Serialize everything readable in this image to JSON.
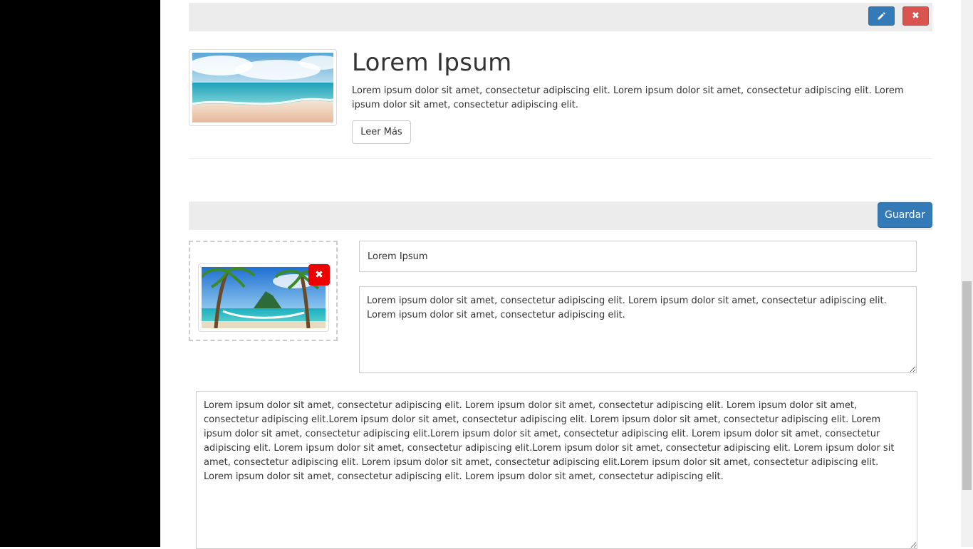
{
  "article": {
    "title": "Lorem Ipsum",
    "summary": "Lorem ipsum dolor sit amet, consectetur adipiscing elit. Lorem ipsum dolor sit amet, consectetur adipiscing elit. Lorem ipsum dolor sit amet, consectetur adipiscing elit.",
    "read_more_label": "Leer Más",
    "edit_icon": "pencil-icon",
    "delete_icon": "close-icon"
  },
  "editor": {
    "save_label": "Guardar",
    "title_value": "Lorem Ipsum",
    "summary_value": "Lorem ipsum dolor sit amet, consectetur adipiscing elit. Lorem ipsum dolor sit amet, consectetur adipiscing elit. Lorem ipsum dolor sit amet, consectetur adipiscing elit.",
    "body_value": "Lorem ipsum dolor sit amet, consectetur adipiscing elit. Lorem ipsum dolor sit amet, consectetur adipiscing elit. Lorem ipsum dolor sit amet, consectetur adipiscing elit.Lorem ipsum dolor sit amet, consectetur adipiscing elit. Lorem ipsum dolor sit amet, consectetur adipiscing elit. Lorem ipsum dolor sit amet, consectetur adipiscing elit.Lorem ipsum dolor sit amet, consectetur adipiscing elit. Lorem ipsum dolor sit amet, consectetur adipiscing elit. Lorem ipsum dolor sit amet, consectetur adipiscing elit.Lorem ipsum dolor sit amet, consectetur adipiscing elit. Lorem ipsum dolor sit amet, consectetur adipiscing elit. Lorem ipsum dolor sit amet, consectetur adipiscing elit.Lorem ipsum dolor sit amet, consectetur adipiscing elit. Lorem ipsum dolor sit amet, consectetur adipiscing elit. Lorem ipsum dolor sit amet, consectetur adipiscing elit.",
    "remove_image_icon": "close-icon"
  },
  "colors": {
    "primary": "#337ab7",
    "danger": "#d9534f",
    "remove_red": "#ee0000",
    "toolbar_bg": "#ececec"
  }
}
